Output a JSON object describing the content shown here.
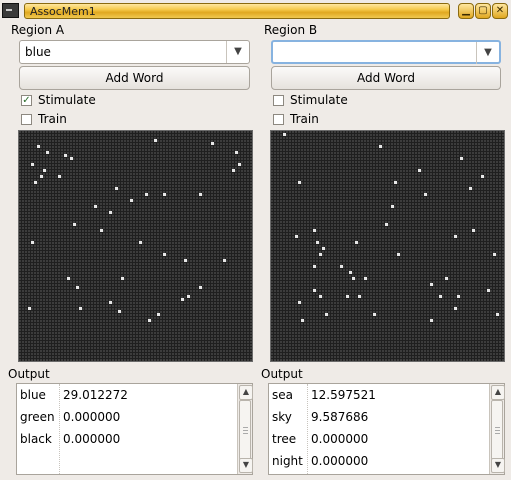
{
  "window": {
    "title": "AssocMem1",
    "buttons": [
      "minimize-icon",
      "maximize-icon",
      "close-icon"
    ]
  },
  "regions": [
    {
      "id": "a",
      "label": "Region A",
      "combo_value": "blue",
      "add_word_label": "Add Word",
      "stimulate": {
        "label": "Stimulate",
        "checked": true
      },
      "train": {
        "label": "Train",
        "checked": false
      },
      "output_label": "Output",
      "output_rows": [
        {
          "word": "blue",
          "value": "29.012272"
        },
        {
          "word": "green",
          "value": "0.000000"
        },
        {
          "word": "black",
          "value": "0.000000"
        }
      ],
      "lit_cells": [
        [
          45,
          2
        ],
        [
          6,
          4
        ],
        [
          7,
          14
        ],
        [
          15,
          7
        ],
        [
          9,
          6
        ],
        [
          13,
          14
        ],
        [
          4,
          10
        ],
        [
          17,
          8
        ],
        [
          8,
          12
        ],
        [
          5,
          16
        ],
        [
          32,
          18
        ],
        [
          37,
          22
        ],
        [
          42,
          20
        ],
        [
          48,
          20
        ],
        [
          30,
          26
        ],
        [
          27,
          32
        ],
        [
          18,
          30
        ],
        [
          4,
          36
        ],
        [
          40,
          36
        ],
        [
          48,
          40
        ],
        [
          3,
          58
        ],
        [
          55,
          42
        ],
        [
          16,
          48
        ],
        [
          19,
          51
        ],
        [
          20,
          58
        ],
        [
          25,
          24
        ],
        [
          34,
          48
        ],
        [
          30,
          56
        ],
        [
          33,
          59
        ],
        [
          43,
          62
        ],
        [
          46,
          60
        ],
        [
          54,
          55
        ],
        [
          56,
          54
        ],
        [
          60,
          20
        ],
        [
          60,
          51
        ],
        [
          64,
          3
        ],
        [
          68,
          42
        ],
        [
          71,
          12
        ],
        [
          72,
          6
        ],
        [
          73,
          10
        ]
      ]
    },
    {
      "id": "b",
      "label": "Region B",
      "combo_value": "",
      "add_word_label": "Add Word",
      "stimulate": {
        "label": "Stimulate",
        "checked": false
      },
      "train": {
        "label": "Train",
        "checked": false
      },
      "output_label": "Output",
      "output_rows": [
        {
          "word": "sea",
          "value": "12.597521"
        },
        {
          "word": "sky",
          "value": "9.587686"
        },
        {
          "word": "tree",
          "value": "0.000000"
        },
        {
          "word": "night",
          "value": "0.000000"
        }
      ],
      "lit_cells": [
        [
          4,
          0
        ],
        [
          9,
          16
        ],
        [
          8,
          34
        ],
        [
          14,
          32
        ],
        [
          14,
          44
        ],
        [
          15,
          36
        ],
        [
          16,
          40
        ],
        [
          17,
          38
        ],
        [
          9,
          56
        ],
        [
          14,
          52
        ],
        [
          16,
          54
        ],
        [
          18,
          60
        ],
        [
          23,
          44
        ],
        [
          25,
          54
        ],
        [
          26,
          46
        ],
        [
          27,
          48
        ],
        [
          28,
          36
        ],
        [
          29,
          54
        ],
        [
          31,
          48
        ],
        [
          34,
          60
        ],
        [
          36,
          4
        ],
        [
          38,
          30
        ],
        [
          40,
          24
        ],
        [
          41,
          16
        ],
        [
          42,
          40
        ],
        [
          49,
          12
        ],
        [
          51,
          20
        ],
        [
          53,
          50
        ],
        [
          53,
          62
        ],
        [
          56,
          54
        ],
        [
          58,
          48
        ],
        [
          61,
          34
        ],
        [
          61,
          58
        ],
        [
          62,
          54
        ],
        [
          63,
          8
        ],
        [
          66,
          18
        ],
        [
          67,
          32
        ],
        [
          70,
          14
        ],
        [
          72,
          52
        ],
        [
          74,
          40
        ],
        [
          75,
          60
        ],
        [
          10,
          62
        ]
      ]
    }
  ]
}
